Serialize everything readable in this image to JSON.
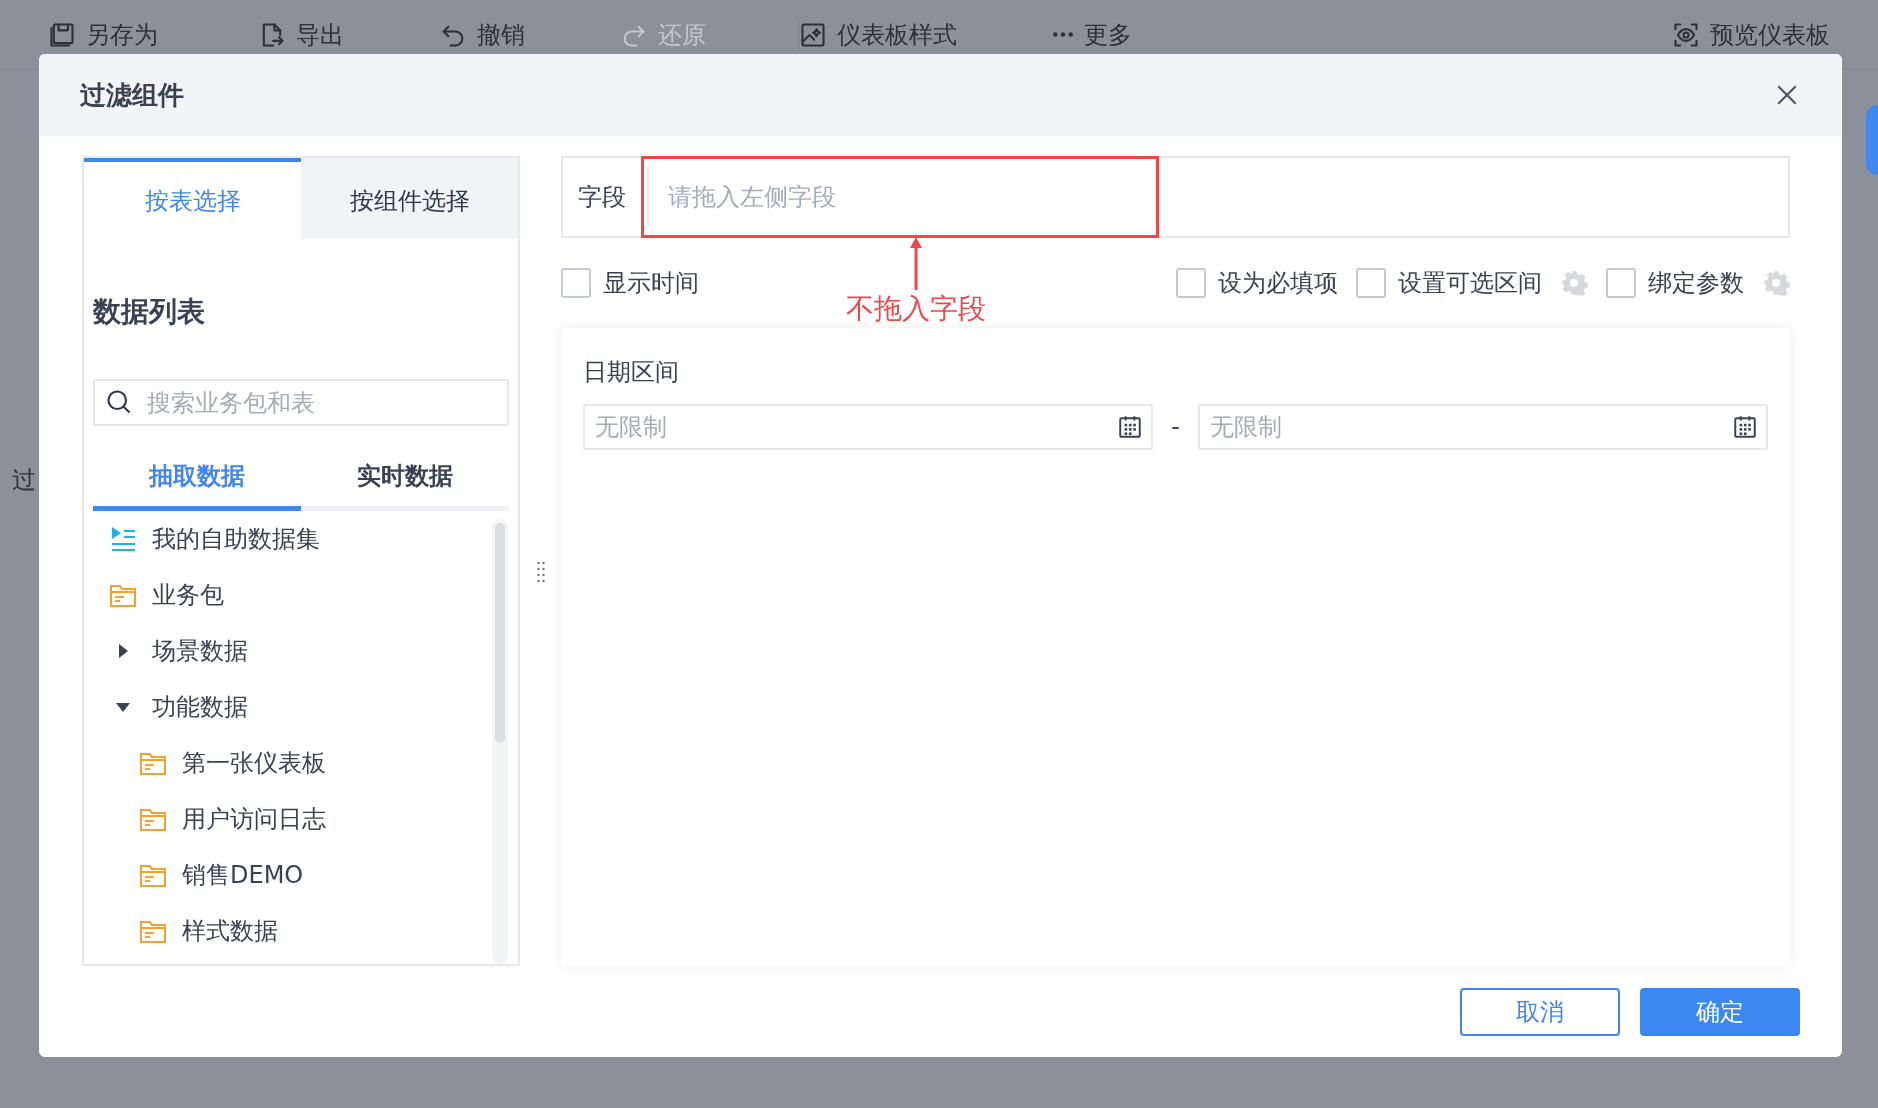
{
  "toolbar": {
    "items": [
      {
        "label": "另存为",
        "kind": "save",
        "disabled": false
      },
      {
        "label": "导出",
        "kind": "export",
        "disabled": false
      },
      {
        "label": "撤销",
        "kind": "undo",
        "disabled": false
      },
      {
        "label": "还原",
        "kind": "redo",
        "disabled": true
      },
      {
        "label": "仪表板样式",
        "kind": "style",
        "disabled": false
      },
      {
        "label": "更多",
        "kind": "more",
        "disabled": false
      },
      {
        "label": "预览仪表板",
        "kind": "preview",
        "disabled": false
      }
    ]
  },
  "background_text": "过",
  "dialog": {
    "title": "过滤组件",
    "source_tabs": [
      {
        "label": "按表选择",
        "selected": true
      },
      {
        "label": "按组件选择",
        "selected": false
      }
    ],
    "list_title": "数据列表",
    "search": {
      "placeholder": "搜索业务包和表"
    },
    "data_tabs": [
      {
        "label": "抽取数据",
        "selected": true
      },
      {
        "label": "实时数据",
        "selected": false
      }
    ],
    "tree": [
      {
        "label": "我的自助数据集",
        "kind": "dataset"
      },
      {
        "label": "业务包",
        "kind": "folder"
      },
      {
        "label": "场景数据",
        "kind": "group",
        "expanded": false
      },
      {
        "label": "功能数据",
        "kind": "group",
        "expanded": true,
        "children": [
          {
            "label": "第一张仪表板",
            "kind": "folder"
          },
          {
            "label": "用户访问日志",
            "kind": "folder"
          },
          {
            "label": "销售DEMO",
            "kind": "folder"
          },
          {
            "label": "样式数据",
            "kind": "folder"
          }
        ]
      }
    ],
    "field": {
      "label": "字段",
      "placeholder": "请拖入左侧字段"
    },
    "annotation": "不拖入字段",
    "display_options": [
      {
        "label": "显示时间",
        "checked": false,
        "has_settings": false
      }
    ],
    "constraint_options": [
      {
        "label": "设为必填项",
        "checked": false,
        "has_settings": false
      },
      {
        "label": "设置可选区间",
        "checked": false,
        "has_settings": true
      },
      {
        "label": "绑定参数",
        "checked": false,
        "has_settings": true
      }
    ],
    "date_range": {
      "label": "日期区间",
      "start": {
        "placeholder": "无限制"
      },
      "separator": "-",
      "end": {
        "placeholder": "无限制"
      }
    },
    "buttons": [
      {
        "label": "取消",
        "kind": "secondary"
      },
      {
        "label": "确定",
        "kind": "primary"
      }
    ]
  }
}
